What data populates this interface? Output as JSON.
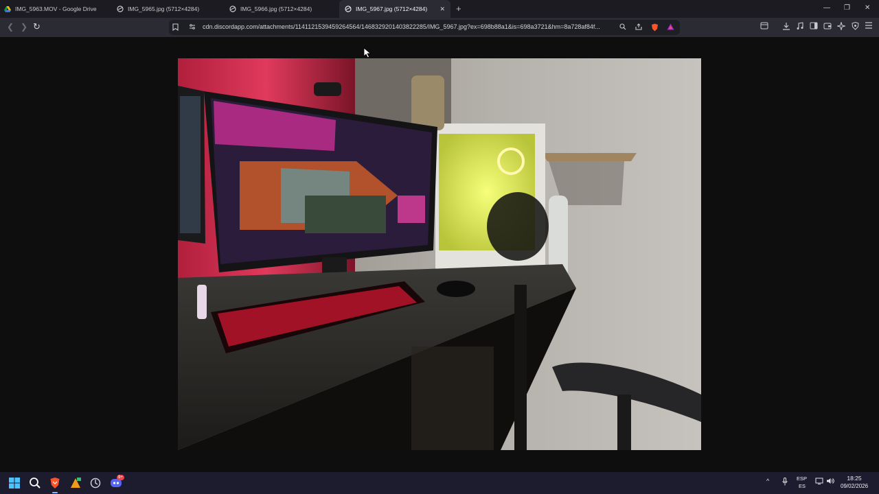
{
  "tabs": [
    {
      "title": "IMG_5963.MOV - Google Drive",
      "icon": "google-drive-icon",
      "active": false
    },
    {
      "title": "IMG_5965.jpg (5712×4284)",
      "icon": "globe-icon",
      "active": false
    },
    {
      "title": "IMG_5966.jpg (5712×4284)",
      "icon": "globe-icon",
      "active": false
    },
    {
      "title": "IMG_5967.jpg (5712×4284)",
      "icon": "globe-icon",
      "active": true
    }
  ],
  "address_bar": {
    "url": "cdn.discordapp.com/attachments/1141121539459264564/1468329201403822285/IMG_5967.jpg?ex=698b88a1&is=698a3721&hm=8a728af84f..."
  },
  "taskbar": {
    "lang_primary": "ESP",
    "lang_secondary": "ES",
    "time": "18:25",
    "date": "09/02/2026",
    "discord_badge": "9+"
  },
  "colors": {
    "tab_bar": "#1b1b21",
    "toolbar": "#2a2b33",
    "page_bg": "#0e0e0e",
    "taskbar": "#1d1b2e",
    "brave_orange": "#fb542b"
  }
}
